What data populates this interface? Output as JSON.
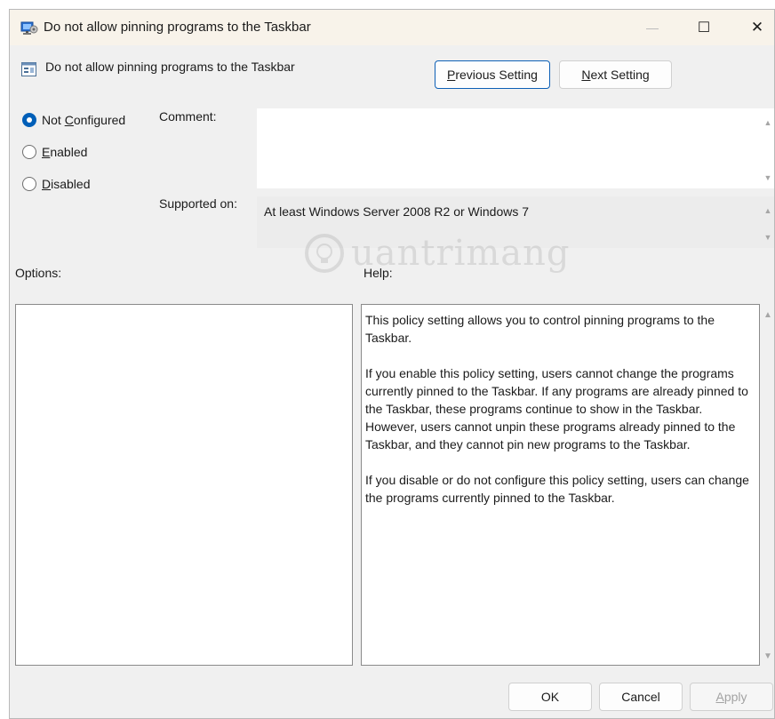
{
  "window": {
    "title": "Do not allow pinning programs to the Taskbar",
    "buttons": {
      "minimize": "—",
      "maximize": "☐",
      "close": "✕"
    }
  },
  "header": {
    "policy_name": "Do not allow pinning programs to the Taskbar",
    "previous_setting": {
      "label_accel": "P",
      "label_rest": "revious Setting"
    },
    "next_setting": {
      "label_accel": "N",
      "label_rest": "ext Setting"
    }
  },
  "state": {
    "options": [
      {
        "pre": "Not ",
        "accel": "C",
        "rest": "onfigured",
        "checked": true
      },
      {
        "pre": "",
        "accel": "E",
        "rest": "nabled",
        "checked": false
      },
      {
        "pre": "",
        "accel": "D",
        "rest": "isabled",
        "checked": false
      }
    ]
  },
  "fields": {
    "comment_label": "Comment:",
    "comment_value": "",
    "supported_label": "Supported on:",
    "supported_value": "At least Windows Server 2008 R2 or Windows 7"
  },
  "sections": {
    "options_label": "Options:",
    "help_label": "Help:"
  },
  "help": {
    "paragraphs": [
      "This policy setting allows you to control pinning programs to the Taskbar.",
      "If you enable this policy setting, users cannot change the programs currently pinned to the Taskbar. If any programs are already pinned to the Taskbar, these programs continue to show in the Taskbar. However, users cannot unpin these programs already pinned to the Taskbar, and they cannot pin new programs to the Taskbar.",
      "If you disable or do not configure this policy setting, users can change the programs currently pinned to the Taskbar."
    ]
  },
  "footer": {
    "ok": "OK",
    "cancel": "Cancel",
    "apply_accel": "A",
    "apply_rest": "pply"
  },
  "watermark": "uantrimang",
  "colors": {
    "accent": "#005fb8",
    "titlebar": "#f8f3ea",
    "dialog_bg": "#f0f0f0"
  }
}
